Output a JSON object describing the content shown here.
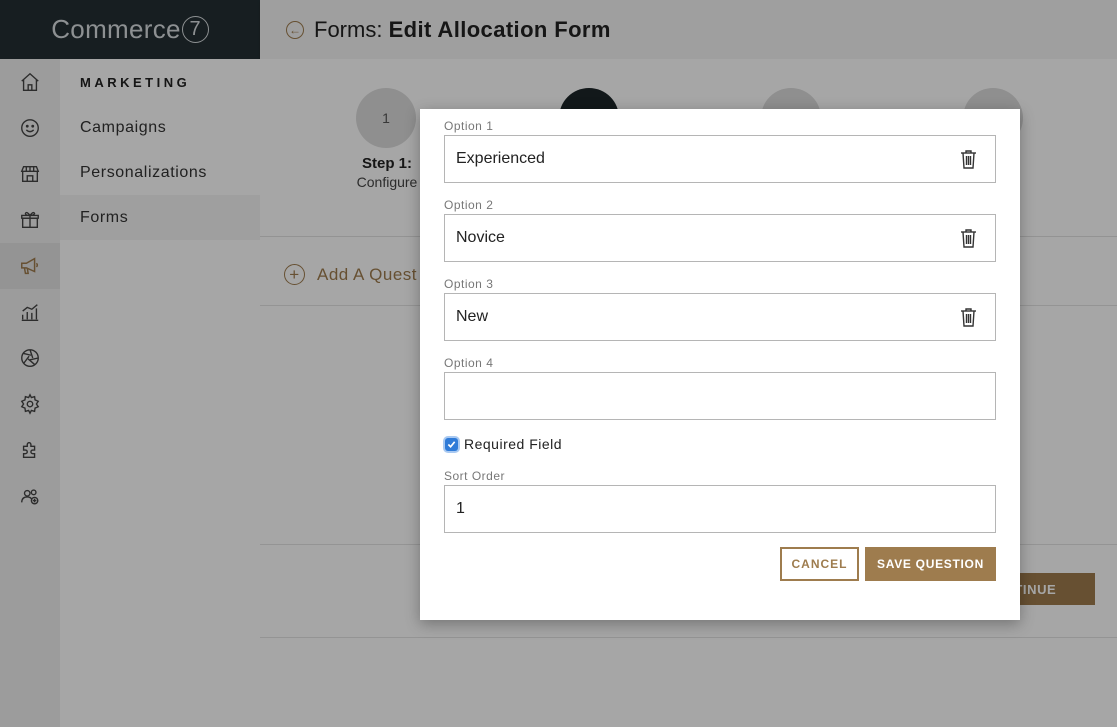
{
  "brand": {
    "name": "Commerce",
    "mark": "7"
  },
  "header": {
    "prefix": "Forms: ",
    "title": "Edit Allocation Form"
  },
  "rail": [
    "home-icon",
    "smiley-icon",
    "store-icon",
    "box-icon",
    "megaphone-icon",
    "chart-icon",
    "aperture-icon",
    "gear-icon",
    "puzzle-icon",
    "users-icon"
  ],
  "submenu": {
    "title": "MARKETING",
    "items": [
      {
        "label": "Campaigns"
      },
      {
        "label": "Personalizations"
      },
      {
        "label": "Forms"
      }
    ]
  },
  "steps": [
    {
      "number": "1",
      "title": "Step 1:",
      "subtitle": "Configure"
    },
    {
      "number": "",
      "title": "",
      "subtitle": ""
    },
    {
      "number": "",
      "title": "",
      "subtitle": ""
    },
    {
      "number": "",
      "title": ":",
      "subtitle": "ns"
    }
  ],
  "main": {
    "add_question": "Add A Quest",
    "continue": "CONTINUE"
  },
  "modal": {
    "options": [
      {
        "label": "Option 1",
        "value": "Experienced"
      },
      {
        "label": "Option 2",
        "value": "Novice"
      },
      {
        "label": "Option 3",
        "value": "New"
      },
      {
        "label": "Option 4",
        "value": ""
      }
    ],
    "required_label": "Required Field",
    "required_checked": true,
    "sort_order_label": "Sort Order",
    "sort_order_value": "1",
    "cancel": "CANCEL",
    "save": "SAVE QUESTION"
  },
  "colors": {
    "accent": "#9e7c4e",
    "brand_bg": "#242f34",
    "checkbox": "#2f7bd8"
  }
}
